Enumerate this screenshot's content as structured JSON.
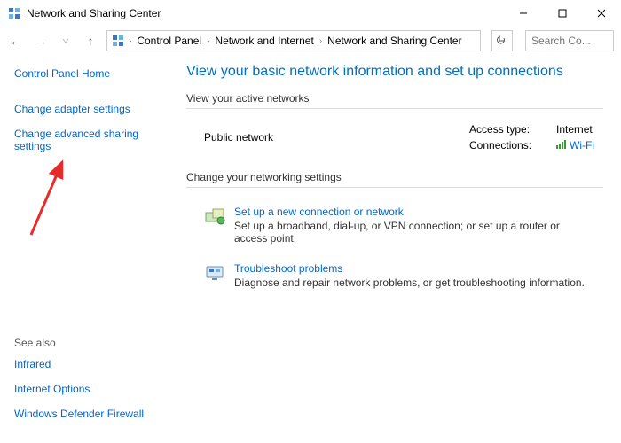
{
  "window": {
    "title": "Network and Sharing Center"
  },
  "breadcrumb": {
    "root": "Control Panel",
    "mid": "Network and Internet",
    "leaf": "Network and Sharing Center"
  },
  "search": {
    "placeholder": "Search Co..."
  },
  "sidebar": {
    "home": "Control Panel Home",
    "adapter": "Change adapter settings",
    "advanced": "Change advanced sharing settings",
    "see_also_label": "See also",
    "see_also": {
      "infrared": "Infrared",
      "inet_opts": "Internet Options",
      "firewall": "Windows Defender Firewall"
    }
  },
  "main": {
    "title": "View your basic network information and set up connections",
    "active_hdr": "View your active networks",
    "network_name": "Public network",
    "access_label": "Access type:",
    "access_value": "Internet",
    "conn_label": "Connections:",
    "conn_value": "Wi-Fi",
    "change_hdr": "Change your networking settings",
    "task1_title": "Set up a new connection or network",
    "task1_desc": "Set up a broadband, dial-up, or VPN connection; or set up a router or access point.",
    "task2_title": "Troubleshoot problems",
    "task2_desc": "Diagnose and repair network problems, or get troubleshooting information."
  }
}
